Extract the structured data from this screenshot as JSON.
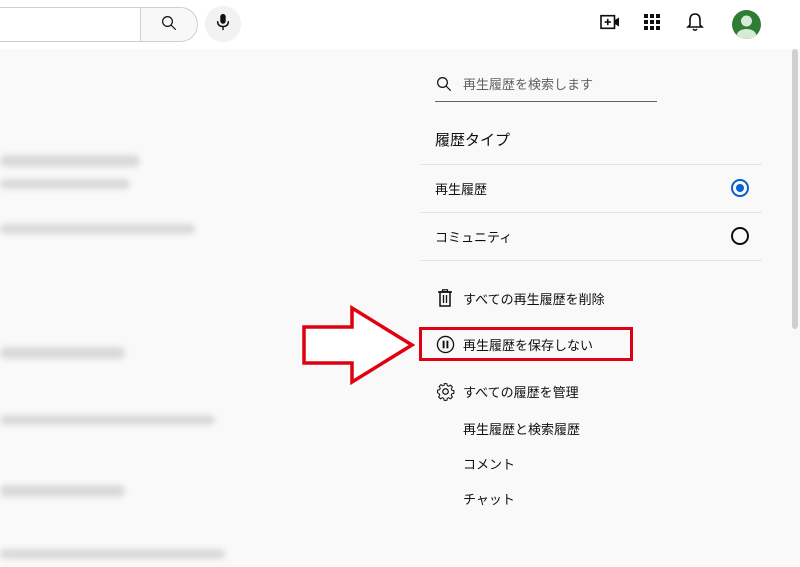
{
  "header": {
    "search_icon": "search-icon",
    "mic_icon": "mic-icon",
    "create_icon": "create-video-icon",
    "apps_icon": "apps-grid-icon",
    "notifications_icon": "bell-icon",
    "avatar_icon": "avatar-icon"
  },
  "panel": {
    "search_placeholder": "再生履歴を検索します",
    "history_type_title": "履歴タイプ",
    "history_types": [
      {
        "label": "再生履歴",
        "selected": true
      },
      {
        "label": "コミュニティ",
        "selected": false
      }
    ],
    "actions": {
      "delete_all": "すべての再生履歴を削除",
      "pause_history": "再生履歴を保存しない",
      "manage_all": "すべての履歴を管理"
    },
    "manage_links": [
      "再生履歴と検索履歴",
      "コメント",
      "チャット"
    ]
  },
  "colors": {
    "accent": "#065fd4",
    "highlight": "#e0000f",
    "avatar": "#2e7d32"
  }
}
